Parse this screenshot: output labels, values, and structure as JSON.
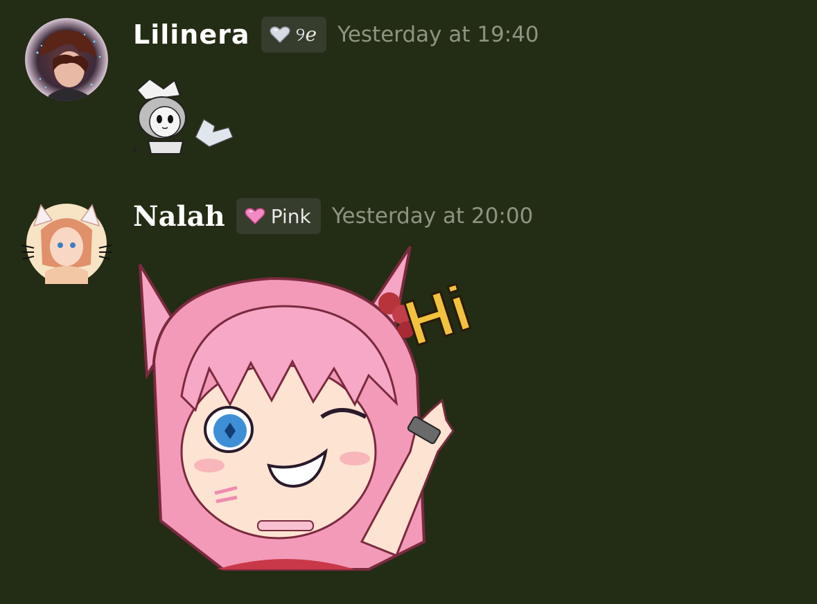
{
  "messages": [
    {
      "username": "Lilinera",
      "role_tag": {
        "icon": "silver-heart-icon",
        "label": "୨ℯ",
        "color": "#d7dbe3"
      },
      "timestamp": "Yesterday at 19:40",
      "sticker": "chibi-grayscale-sticker"
    },
    {
      "username": "Nalah",
      "role_tag": {
        "icon": "pink-heart-icon",
        "label": "Pink",
        "color": "#f08bc4"
      },
      "timestamp": "Yesterday at 20:00",
      "sticker": "pink-catgirl-hi-sticker",
      "sticker_text": "Hi"
    }
  ],
  "colors": {
    "background": "#232c14",
    "tag_bg": "#363d2c",
    "timestamp": "#8f9482"
  }
}
